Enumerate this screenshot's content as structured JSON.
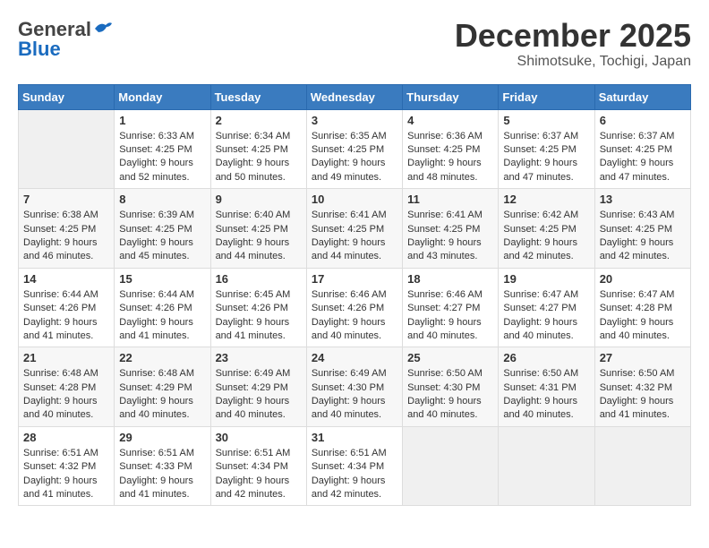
{
  "header": {
    "logo": {
      "line1": "General",
      "line2": "Blue"
    },
    "title": "December 2025",
    "location": "Shimotsuke, Tochigi, Japan"
  },
  "weekdays": [
    "Sunday",
    "Monday",
    "Tuesday",
    "Wednesday",
    "Thursday",
    "Friday",
    "Saturday"
  ],
  "weeks": [
    [
      {
        "day": "",
        "sunrise": "",
        "sunset": "",
        "daylight": "",
        "empty": true
      },
      {
        "day": "1",
        "sunrise": "Sunrise: 6:33 AM",
        "sunset": "Sunset: 4:25 PM",
        "daylight": "Daylight: 9 hours and 52 minutes."
      },
      {
        "day": "2",
        "sunrise": "Sunrise: 6:34 AM",
        "sunset": "Sunset: 4:25 PM",
        "daylight": "Daylight: 9 hours and 50 minutes."
      },
      {
        "day": "3",
        "sunrise": "Sunrise: 6:35 AM",
        "sunset": "Sunset: 4:25 PM",
        "daylight": "Daylight: 9 hours and 49 minutes."
      },
      {
        "day": "4",
        "sunrise": "Sunrise: 6:36 AM",
        "sunset": "Sunset: 4:25 PM",
        "daylight": "Daylight: 9 hours and 48 minutes."
      },
      {
        "day": "5",
        "sunrise": "Sunrise: 6:37 AM",
        "sunset": "Sunset: 4:25 PM",
        "daylight": "Daylight: 9 hours and 47 minutes."
      },
      {
        "day": "6",
        "sunrise": "Sunrise: 6:37 AM",
        "sunset": "Sunset: 4:25 PM",
        "daylight": "Daylight: 9 hours and 47 minutes."
      }
    ],
    [
      {
        "day": "7",
        "sunrise": "Sunrise: 6:38 AM",
        "sunset": "Sunset: 4:25 PM",
        "daylight": "Daylight: 9 hours and 46 minutes."
      },
      {
        "day": "8",
        "sunrise": "Sunrise: 6:39 AM",
        "sunset": "Sunset: 4:25 PM",
        "daylight": "Daylight: 9 hours and 45 minutes."
      },
      {
        "day": "9",
        "sunrise": "Sunrise: 6:40 AM",
        "sunset": "Sunset: 4:25 PM",
        "daylight": "Daylight: 9 hours and 44 minutes."
      },
      {
        "day": "10",
        "sunrise": "Sunrise: 6:41 AM",
        "sunset": "Sunset: 4:25 PM",
        "daylight": "Daylight: 9 hours and 44 minutes."
      },
      {
        "day": "11",
        "sunrise": "Sunrise: 6:41 AM",
        "sunset": "Sunset: 4:25 PM",
        "daylight": "Daylight: 9 hours and 43 minutes."
      },
      {
        "day": "12",
        "sunrise": "Sunrise: 6:42 AM",
        "sunset": "Sunset: 4:25 PM",
        "daylight": "Daylight: 9 hours and 42 minutes."
      },
      {
        "day": "13",
        "sunrise": "Sunrise: 6:43 AM",
        "sunset": "Sunset: 4:25 PM",
        "daylight": "Daylight: 9 hours and 42 minutes."
      }
    ],
    [
      {
        "day": "14",
        "sunrise": "Sunrise: 6:44 AM",
        "sunset": "Sunset: 4:26 PM",
        "daylight": "Daylight: 9 hours and 41 minutes."
      },
      {
        "day": "15",
        "sunrise": "Sunrise: 6:44 AM",
        "sunset": "Sunset: 4:26 PM",
        "daylight": "Daylight: 9 hours and 41 minutes."
      },
      {
        "day": "16",
        "sunrise": "Sunrise: 6:45 AM",
        "sunset": "Sunset: 4:26 PM",
        "daylight": "Daylight: 9 hours and 41 minutes."
      },
      {
        "day": "17",
        "sunrise": "Sunrise: 6:46 AM",
        "sunset": "Sunset: 4:26 PM",
        "daylight": "Daylight: 9 hours and 40 minutes."
      },
      {
        "day": "18",
        "sunrise": "Sunrise: 6:46 AM",
        "sunset": "Sunset: 4:27 PM",
        "daylight": "Daylight: 9 hours and 40 minutes."
      },
      {
        "day": "19",
        "sunrise": "Sunrise: 6:47 AM",
        "sunset": "Sunset: 4:27 PM",
        "daylight": "Daylight: 9 hours and 40 minutes."
      },
      {
        "day": "20",
        "sunrise": "Sunrise: 6:47 AM",
        "sunset": "Sunset: 4:28 PM",
        "daylight": "Daylight: 9 hours and 40 minutes."
      }
    ],
    [
      {
        "day": "21",
        "sunrise": "Sunrise: 6:48 AM",
        "sunset": "Sunset: 4:28 PM",
        "daylight": "Daylight: 9 hours and 40 minutes."
      },
      {
        "day": "22",
        "sunrise": "Sunrise: 6:48 AM",
        "sunset": "Sunset: 4:29 PM",
        "daylight": "Daylight: 9 hours and 40 minutes."
      },
      {
        "day": "23",
        "sunrise": "Sunrise: 6:49 AM",
        "sunset": "Sunset: 4:29 PM",
        "daylight": "Daylight: 9 hours and 40 minutes."
      },
      {
        "day": "24",
        "sunrise": "Sunrise: 6:49 AM",
        "sunset": "Sunset: 4:30 PM",
        "daylight": "Daylight: 9 hours and 40 minutes."
      },
      {
        "day": "25",
        "sunrise": "Sunrise: 6:50 AM",
        "sunset": "Sunset: 4:30 PM",
        "daylight": "Daylight: 9 hours and 40 minutes."
      },
      {
        "day": "26",
        "sunrise": "Sunrise: 6:50 AM",
        "sunset": "Sunset: 4:31 PM",
        "daylight": "Daylight: 9 hours and 40 minutes."
      },
      {
        "day": "27",
        "sunrise": "Sunrise: 6:50 AM",
        "sunset": "Sunset: 4:32 PM",
        "daylight": "Daylight: 9 hours and 41 minutes."
      }
    ],
    [
      {
        "day": "28",
        "sunrise": "Sunrise: 6:51 AM",
        "sunset": "Sunset: 4:32 PM",
        "daylight": "Daylight: 9 hours and 41 minutes."
      },
      {
        "day": "29",
        "sunrise": "Sunrise: 6:51 AM",
        "sunset": "Sunset: 4:33 PM",
        "daylight": "Daylight: 9 hours and 41 minutes."
      },
      {
        "day": "30",
        "sunrise": "Sunrise: 6:51 AM",
        "sunset": "Sunset: 4:34 PM",
        "daylight": "Daylight: 9 hours and 42 minutes."
      },
      {
        "day": "31",
        "sunrise": "Sunrise: 6:51 AM",
        "sunset": "Sunset: 4:34 PM",
        "daylight": "Daylight: 9 hours and 42 minutes."
      },
      {
        "day": "",
        "sunrise": "",
        "sunset": "",
        "daylight": "",
        "empty": true
      },
      {
        "day": "",
        "sunrise": "",
        "sunset": "",
        "daylight": "",
        "empty": true
      },
      {
        "day": "",
        "sunrise": "",
        "sunset": "",
        "daylight": "",
        "empty": true
      }
    ]
  ]
}
